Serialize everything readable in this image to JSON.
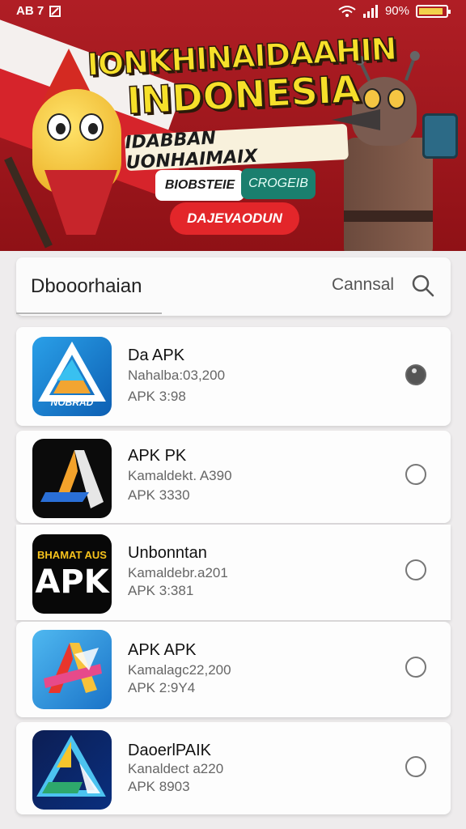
{
  "status_bar": {
    "left_text": "AB 7",
    "battery_text": "90%",
    "battery_level": 0.9,
    "left_icons": [
      "signal-icon",
      "notification-icon"
    ],
    "right_icons": [
      "wifi-icon",
      "cell-signal-icon",
      "battery-icon"
    ]
  },
  "banner": {
    "headline_line1": "IONKHINAIDAAHIN",
    "headline_line2": "INDONESIA",
    "subline": "IDABBAN UONHAIMAIX",
    "tag_white": "BIOBSTEIE",
    "tag_teal": "CROGEIB",
    "cta": "DAJEVAODUN",
    "colors": {
      "background": "#a8181f",
      "headline": "#f6e02a",
      "cta": "#e3262a",
      "teal": "#1a7f6e"
    }
  },
  "search": {
    "value": "Dbooorhaian",
    "cancel_label": "Cannsal"
  },
  "apps": [
    {
      "name": "Da APK",
      "subtitle": "Nahalba:03,200",
      "version": "APK 3:98",
      "selected": true,
      "icon_text": "NOBRAD"
    },
    {
      "name": "APK PK",
      "subtitle": "Kamaldekt. A390",
      "version": "APK 3330",
      "selected": false,
      "icon_text": ""
    },
    {
      "name": "Unbonntan",
      "subtitle": "Kamaldebr.a201",
      "version": "APK 3:381",
      "selected": false,
      "icon_text": "BHAMAT AUS",
      "icon_big_text": "APK"
    },
    {
      "name": "APK APK",
      "subtitle": "Kamalagc22,200",
      "version": "APK 2:9Y4",
      "selected": false,
      "icon_text": ""
    },
    {
      "name": "DaoerlPAIK",
      "subtitle": "Kanaldect a220",
      "version": "APK 8903",
      "selected": false,
      "icon_text": ""
    }
  ]
}
